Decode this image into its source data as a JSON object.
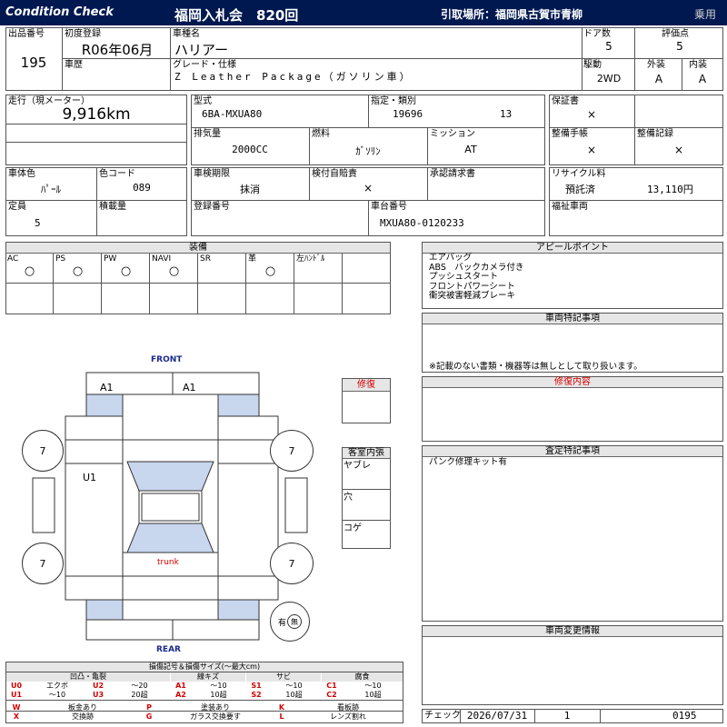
{
  "header": {
    "left_title": "Condition  Check",
    "auction": "福岡入札会　820回",
    "pickup": "引取場所：福岡県古賀市青柳",
    "category": "乗用"
  },
  "row1": {
    "lot_label": "出品番号",
    "lot_value": "195",
    "first_reg_label": "初度登録",
    "first_reg_value": "R06年06月",
    "name_label": "車種名",
    "name_value": "ハリアー",
    "doors_label": "ドア数",
    "doors_value": "5",
    "score_label": "評価点",
    "score_value": "5",
    "history_label": "車歴",
    "grade_label": "グレード・仕様",
    "grade_value": "Z Leather Package（ガソリン車）",
    "drive_label": "駆動",
    "drive_value": "2WD",
    "exterior_label": "外装",
    "exterior_value": "A",
    "interior_label": "内装",
    "interior_value": "A"
  },
  "row2": {
    "mileage_label": "走行（現メーター）",
    "mileage_value": "9,916km",
    "model_label": "型式",
    "model_value": "6BA-MXUA80",
    "spec_label": "指定・類別",
    "spec_value1": "19696",
    "spec_value2": "13",
    "warranty_label": "保証書",
    "warranty_value": "×",
    "displacement_label": "排気量",
    "displacement_value": "2000CC",
    "fuel_label": "燃料",
    "fuel_value": "ｶﾞｿﾘﾝ",
    "mission_label": "ミッション",
    "mission_value": "AT",
    "manual_label": "整備手帳",
    "manual_value": "×",
    "record_label": "整備記録",
    "record_value": "×"
  },
  "row3": {
    "color_label": "車体色",
    "color_value": "ﾊﾟｰﾙ",
    "color_code_label": "色コード",
    "color_code_value": "089",
    "inspection_label": "車検期限",
    "inspection_value": "抹消",
    "insurance_label": "検付自賠責",
    "insurance_value": "×",
    "approval_label": "承認請求書",
    "recycle_label": "リサイクル料",
    "recycle_status": "預託済",
    "recycle_value": "13,110円",
    "capacity_label": "定員",
    "capacity_value": "5",
    "load_label": "積載量",
    "reg_label": "登録番号",
    "chassis_label": "車台番号",
    "chassis_value": "MXUA80-0120233",
    "welfare_label": "福祉車両"
  },
  "equipment": {
    "title": "装備",
    "items": [
      {
        "label": "AC",
        "value": "○"
      },
      {
        "label": "PS",
        "value": "○"
      },
      {
        "label": "PW",
        "value": "○"
      },
      {
        "label": "NAVI",
        "value": "○"
      },
      {
        "label": "SR",
        "value": ""
      },
      {
        "label": "革",
        "value": "○"
      },
      {
        "label": "左ﾊﾝﾄﾞﾙ",
        "value": ""
      }
    ]
  },
  "appeal": {
    "title": "アピールポイント",
    "lines": [
      "エアバッグ",
      "ABS　バックカメラ付き",
      "プッシュスタート",
      "フロントパワーシート",
      "衝突被害軽減ブレーキ"
    ]
  },
  "special": {
    "title": "車両特記事項",
    "note": "※記載のない書類・機器等は無しとして取り扱います。"
  },
  "repair_content": {
    "title": "修復内容"
  },
  "inspector": {
    "title": "査定特記事項",
    "line1": "パンク修理キット有"
  },
  "changes": {
    "title": "車両変更情報"
  },
  "diagram": {
    "front": "FRONT",
    "rear": "REAR",
    "a1_left": "A1",
    "a1_right": "A1",
    "u1": "U1",
    "trunk": "trunk",
    "tire_fl": "7",
    "tire_fr": "7",
    "tire_rl": "7",
    "tire_rr": "7",
    "spare": "有",
    "spare_mark": "無"
  },
  "repair_box": {
    "title": "修復"
  },
  "interior_dirt": {
    "title": "客室内張",
    "row1": "ヤブレ",
    "row2": "穴",
    "row3": "コゲ"
  },
  "legend": {
    "title": "損傷記号＆損傷サイズ(～最大cm)",
    "h1": "凹凸・亀裂",
    "h2": "線キズ",
    "h3": "サビ",
    "h4": "腐食",
    "r1": [
      {
        "code": "U0",
        "desc": "エクボ"
      },
      {
        "code": "U2",
        "desc": "～20"
      },
      {
        "code": "A1",
        "desc": "～10"
      },
      {
        "code": "S1",
        "desc": "～10"
      },
      {
        "code": "C1",
        "desc": "～10"
      }
    ],
    "r2": [
      {
        "code": "U1",
        "desc": "～10"
      },
      {
        "code": "U3",
        "desc": "20超"
      },
      {
        "code": "A2",
        "desc": "10超"
      },
      {
        "code": "S2",
        "desc": "10超"
      },
      {
        "code": "C2",
        "desc": "10超"
      }
    ],
    "r3": [
      {
        "code": "W",
        "desc": "板金あり"
      },
      {
        "code": "P",
        "desc": "塗装あり"
      },
      {
        "code": "K",
        "desc": "看板跡"
      }
    ],
    "r4": [
      {
        "code": "X",
        "desc": "交換跡"
      },
      {
        "code": "G",
        "desc": "ガラス交換要す"
      },
      {
        "code": "L",
        "desc": "レンズ割れ"
      }
    ]
  },
  "footer": {
    "check_label": "チェック",
    "date": "2026/07/31",
    "count": "1",
    "number": "0195"
  },
  "colors": {
    "header_bg": "#001850",
    "red": "#d40000",
    "blue_fill": "#c8d6ee",
    "front_blue": "#1a2a8a"
  }
}
